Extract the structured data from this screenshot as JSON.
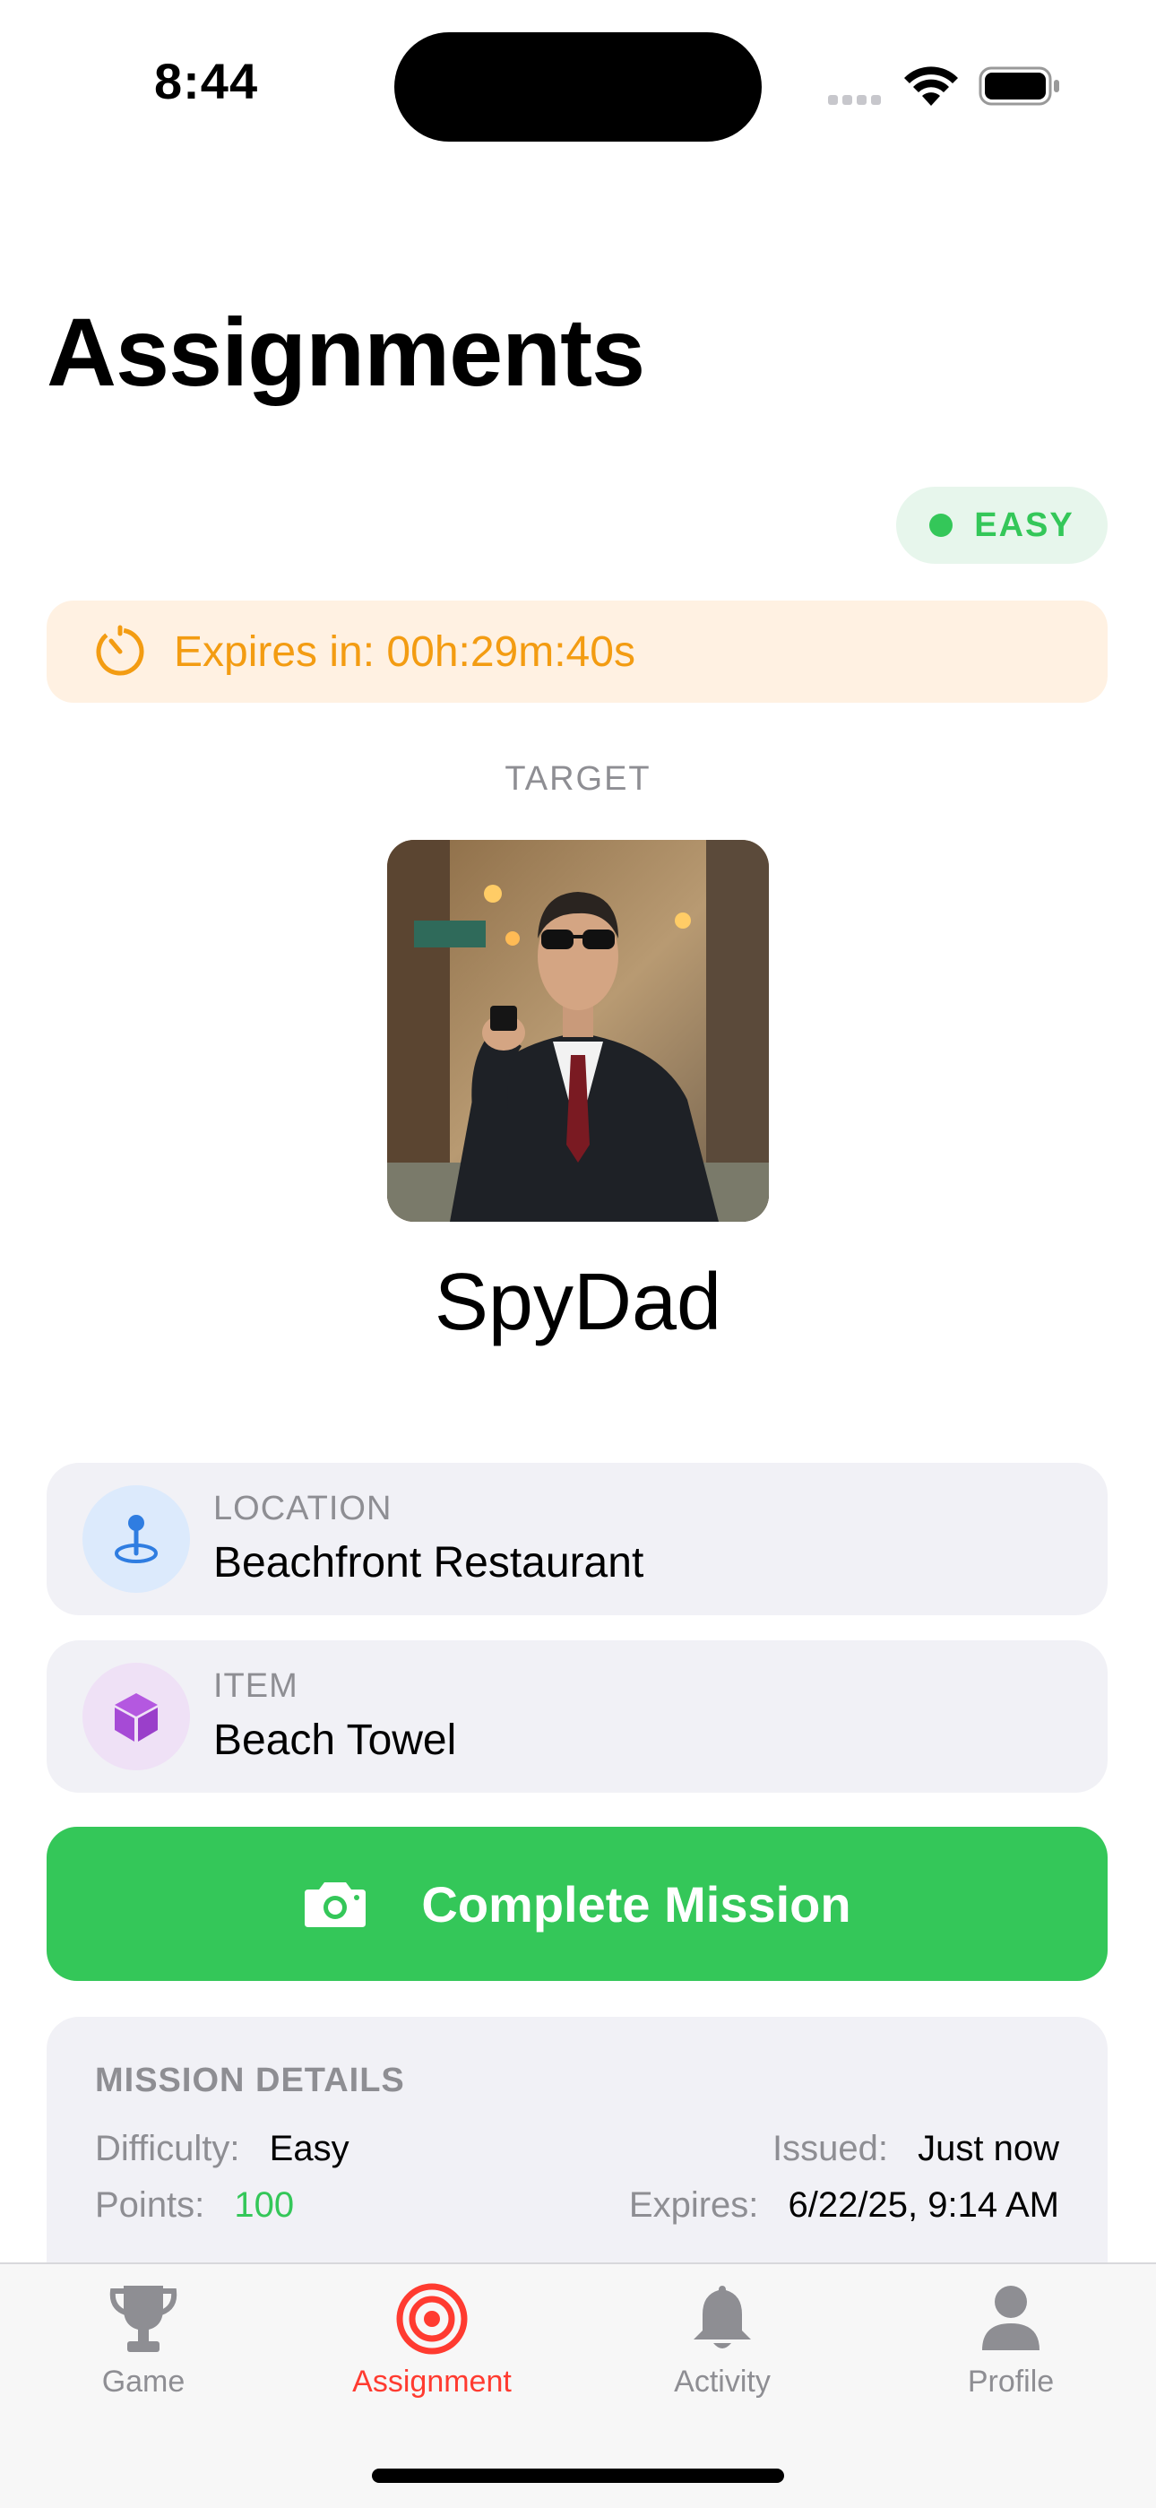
{
  "status_bar": {
    "time": "8:44"
  },
  "header": {
    "title": "Assignments"
  },
  "difficulty_badge": {
    "label": "EASY"
  },
  "expiry": {
    "text": "Expires in: 00h:29m:40s"
  },
  "target": {
    "section_label": "TARGET",
    "name": "SpyDad"
  },
  "location": {
    "label": "LOCATION",
    "value": "Beachfront Restaurant"
  },
  "item": {
    "label": "ITEM",
    "value": "Beach Towel"
  },
  "action": {
    "complete_label": "Complete Mission"
  },
  "mission_details": {
    "heading": "MISSION DETAILS",
    "difficulty_label": "Difficulty:",
    "difficulty_value": "Easy",
    "points_label": "Points:",
    "points_value": "100",
    "issued_label": "Issued:",
    "issued_value": "Just now",
    "expires_label": "Expires:",
    "expires_value": "6/22/25, 9:14 AM"
  },
  "tabs": [
    {
      "label": "Game",
      "icon": "trophy-icon",
      "active": false
    },
    {
      "label": "Assignment",
      "icon": "target-icon",
      "active": true
    },
    {
      "label": "Activity",
      "icon": "bell-icon",
      "active": false
    },
    {
      "label": "Profile",
      "icon": "person-icon",
      "active": false
    }
  ],
  "colors": {
    "accent_green": "#34c759",
    "accent_orange": "#f39c12",
    "active_tab": "#ff3b30"
  }
}
